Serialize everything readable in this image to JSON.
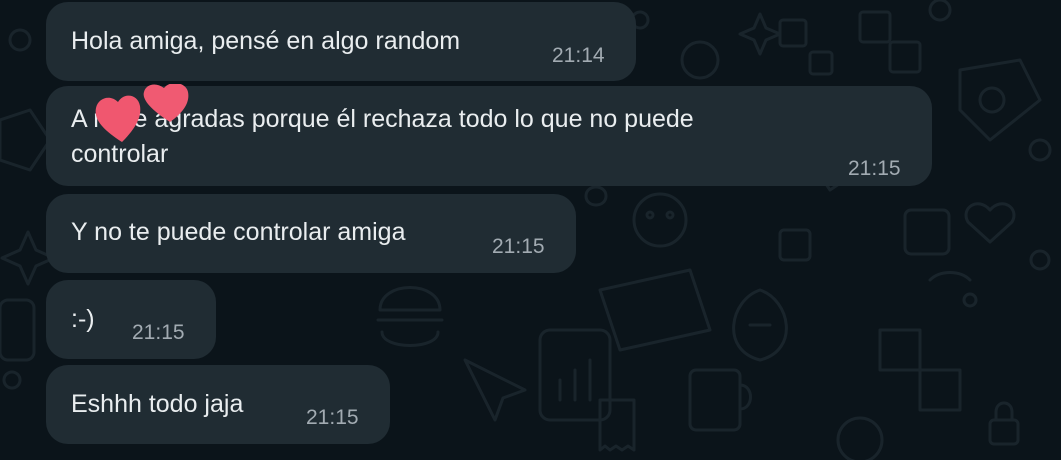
{
  "chat": {
    "messages": [
      {
        "text": "Hola amiga, pensé en algo random",
        "time": "21:14"
      },
      {
        "text_line1": "A      no le agradas porque él rechaza todo lo que no puede",
        "text_line2": "controlar",
        "time": "21:15"
      },
      {
        "text": "Y no te puede controlar amiga",
        "time": "21:15"
      },
      {
        "text": ":-)",
        "time": "21:15"
      },
      {
        "text": "Eshhh todo jaja",
        "time": "21:15"
      }
    ]
  },
  "colors": {
    "background": "#0b141a",
    "bubble_incoming": "#202c33",
    "text": "#e9edef",
    "timestamp": "#a2abb2",
    "heart_sticker": "#f0576f"
  },
  "icons": [
    "wallpaper-doodle-pattern",
    "heart-sticker"
  ]
}
